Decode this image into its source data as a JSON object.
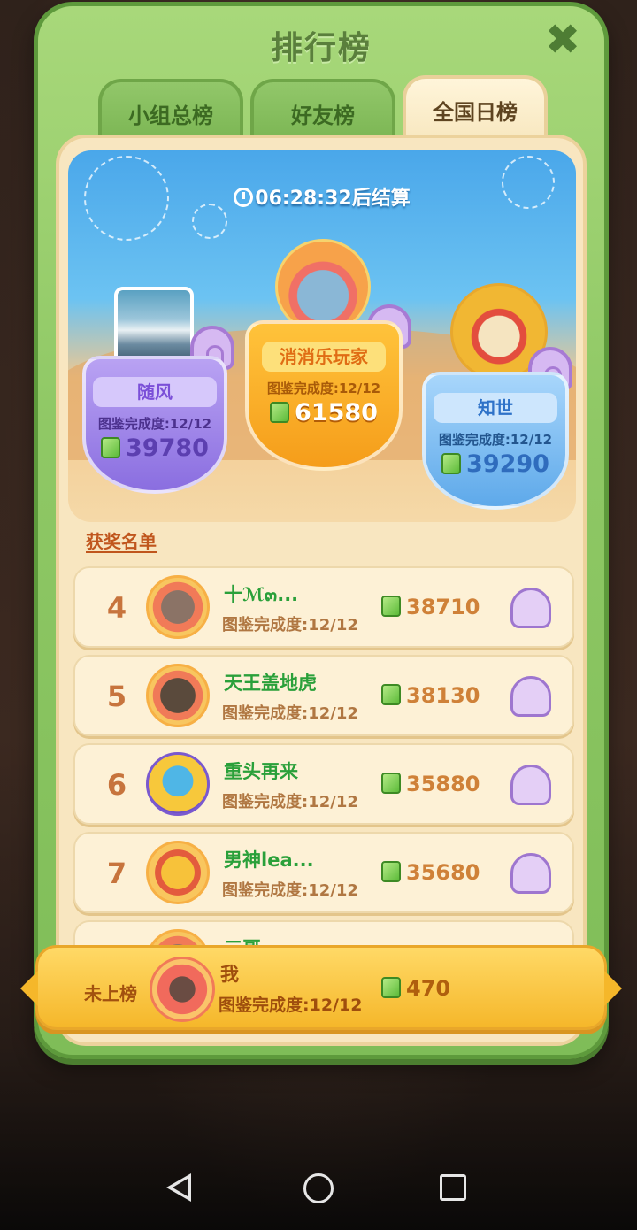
{
  "window": {
    "title": "排行榜"
  },
  "tabs": [
    {
      "label": "小组总榜"
    },
    {
      "label": "好友榜"
    },
    {
      "label": "全国日榜"
    }
  ],
  "timer": {
    "text": "06:28:32后结算"
  },
  "podium": {
    "first": {
      "name": "消消乐玩家",
      "completion": "图鉴完成度:12/12",
      "score": "61580"
    },
    "second": {
      "name": "随风",
      "completion": "图鉴完成度:12/12",
      "score": "39780"
    },
    "third": {
      "name": "知世",
      "completion": "图鉴完成度:12/12",
      "score": "39290"
    }
  },
  "winners_title": "获奖名单",
  "list": [
    {
      "rank": "4",
      "name": "十ℳ๓...",
      "completion": "图鉴完成度:12/12",
      "score": "38710"
    },
    {
      "rank": "5",
      "name": "天王盖地虎",
      "completion": "图鉴完成度:12/12",
      "score": "38130"
    },
    {
      "rank": "6",
      "name": "重头再来",
      "completion": "图鉴完成度:12/12",
      "score": "35880"
    },
    {
      "rank": "7",
      "name": "男神lea...",
      "completion": "图鉴完成度:12/12",
      "score": "35680"
    },
    {
      "rank": "",
      "name": "三哥",
      "completion": "",
      "score": ""
    }
  ],
  "me": {
    "rank": "未上榜",
    "name": "我",
    "completion": "图鉴完成度:12/12",
    "score": "470"
  },
  "icons": {
    "close": "close-icon",
    "clock": "clock-icon",
    "gem": "gem-icon",
    "reward": "neck-pillow-icon"
  },
  "colors": {
    "panel_green": "#8fc865",
    "gold": "#f5b72a",
    "purple": "#8a6ee0",
    "blue": "#5ea9ea",
    "name_green": "#2aa03a"
  }
}
